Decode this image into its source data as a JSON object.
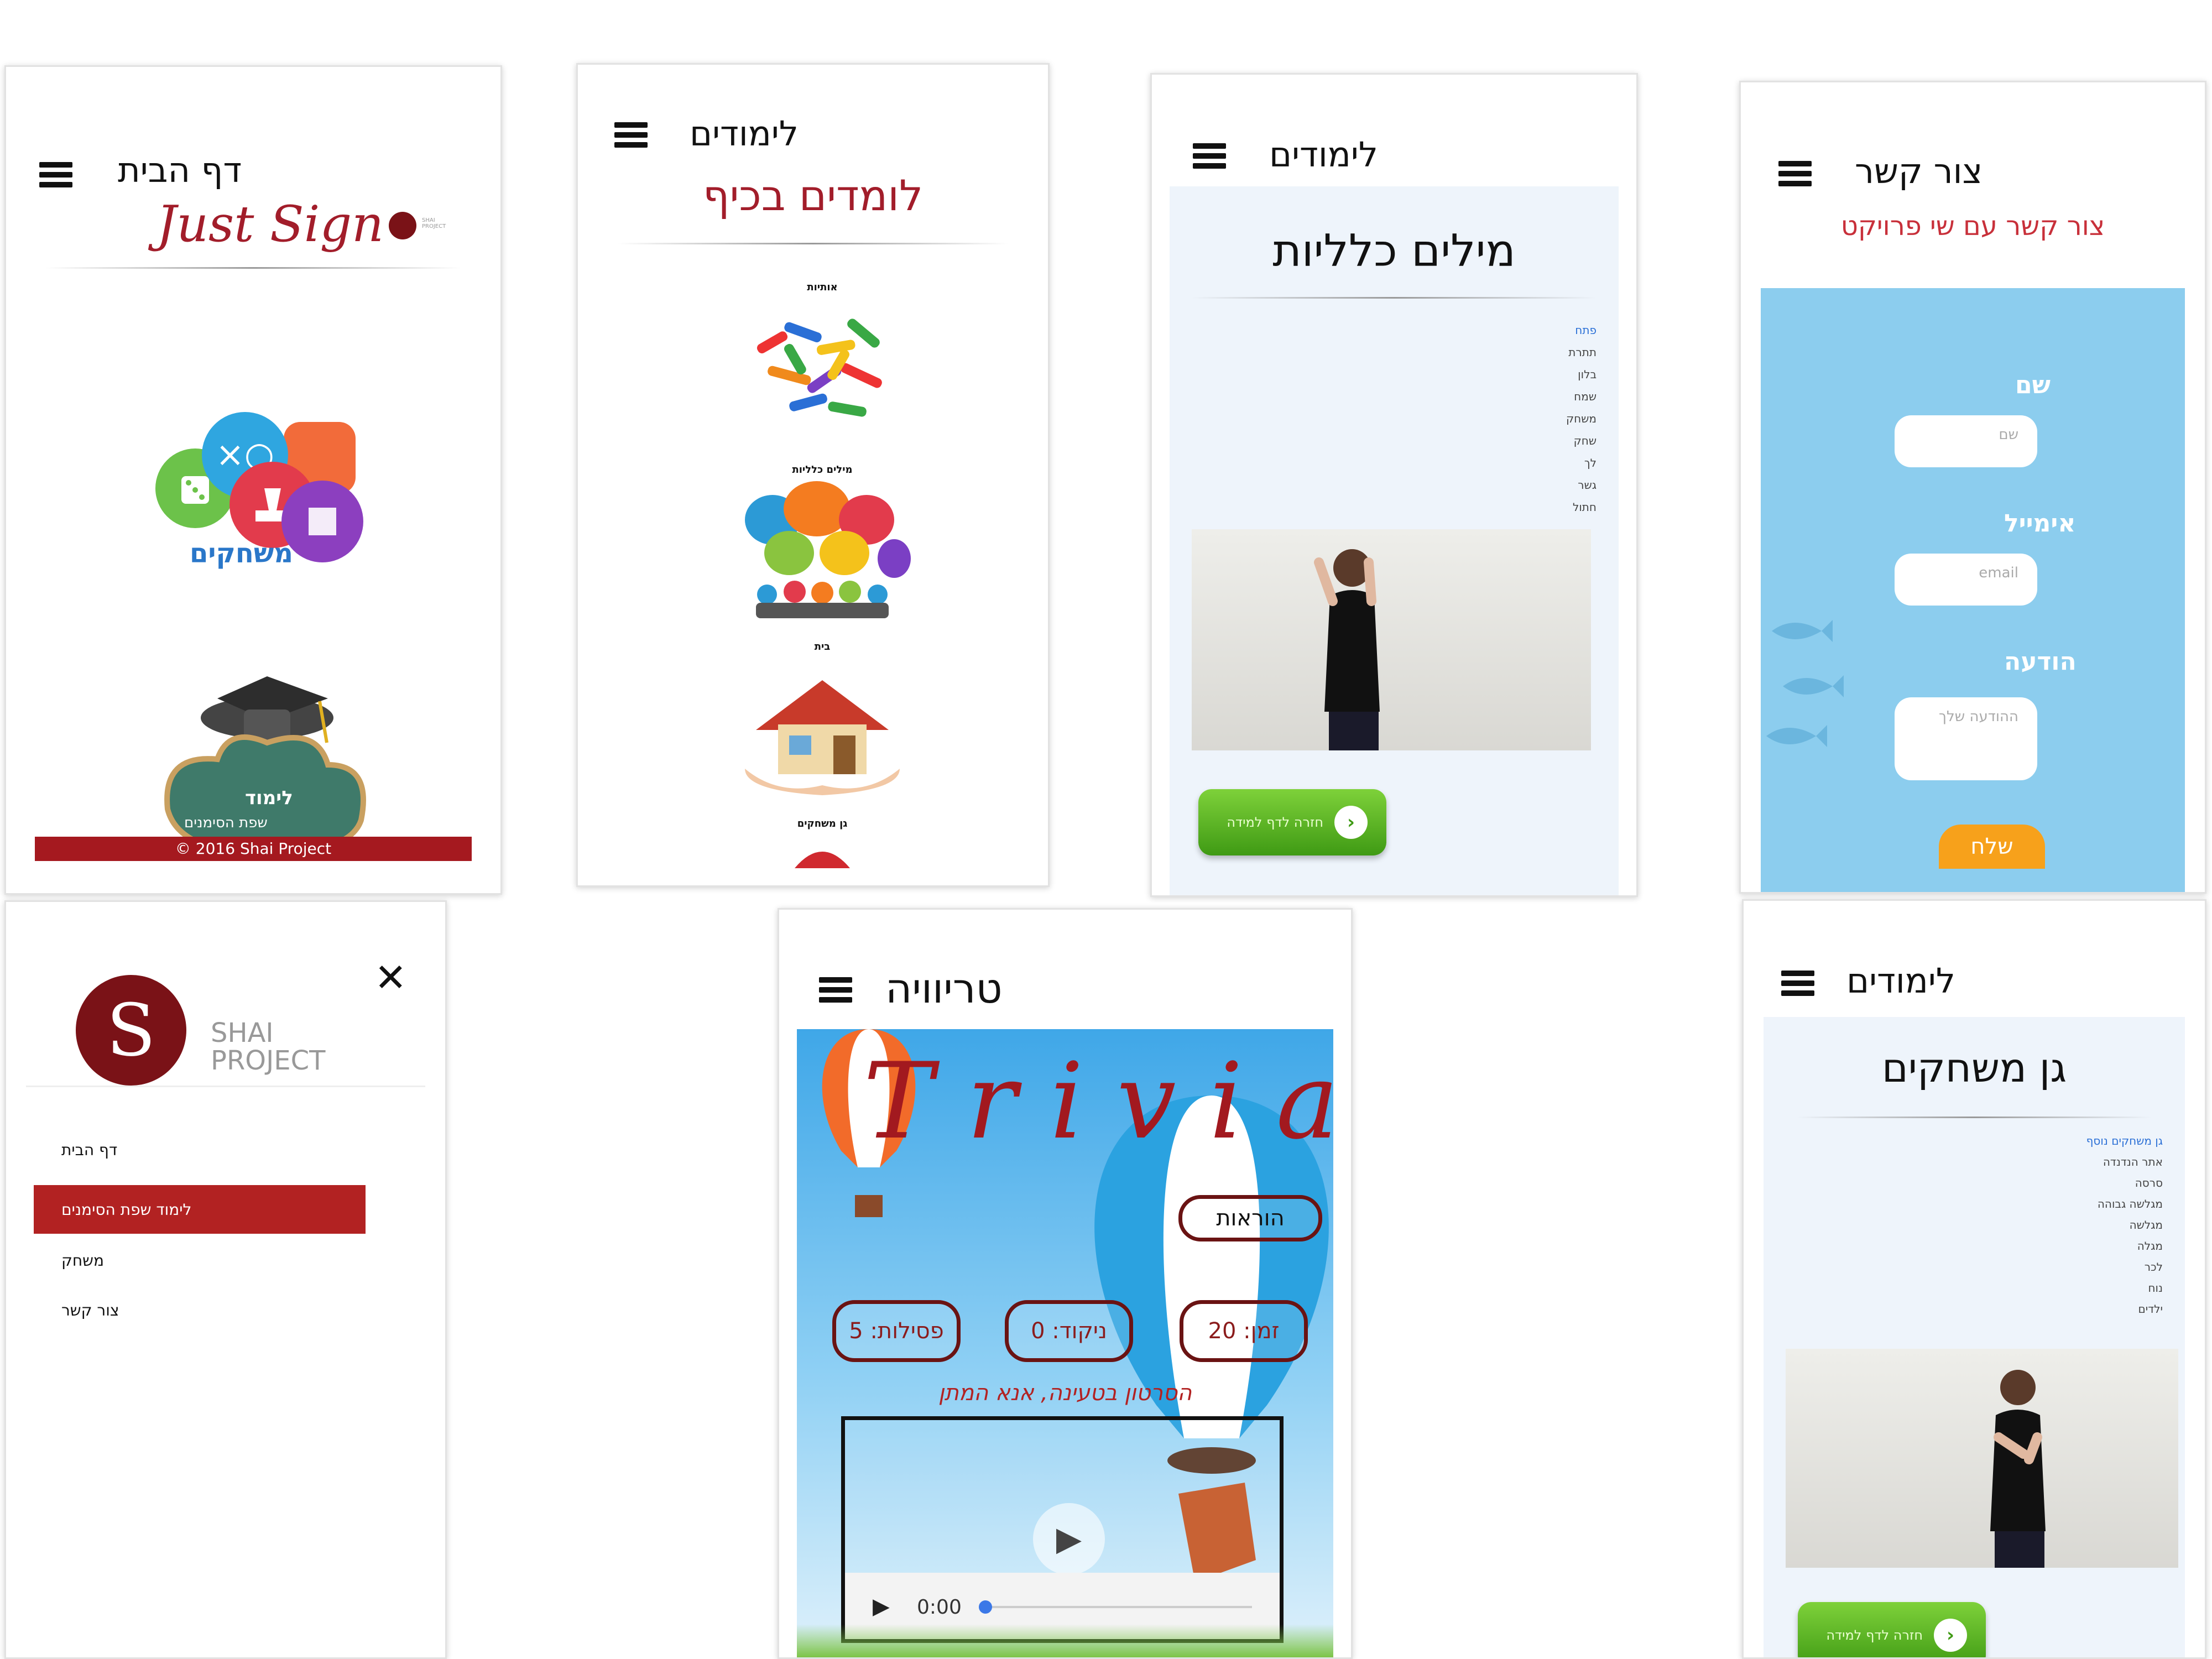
{
  "home": {
    "title": "דף הבית",
    "logo_script": "Just Sign",
    "games_label": "משחקים",
    "learn_label": "לימוד",
    "learn_sub": "שפת הסימנים",
    "footer": "© 2016 Shai Project"
  },
  "learn_menu": {
    "title": "לימודים",
    "subtitle": "לומדים בכיף",
    "items": [
      "אותיות",
      "מילים כלליות",
      "בית",
      "גן משחקים"
    ]
  },
  "general_words": {
    "title": "לימודים",
    "heading": "מילים כלליות",
    "words": [
      "פתח",
      "תתרת",
      "בלון",
      "שמח",
      "משחק",
      "שחק",
      "לך",
      "גשר",
      "חתול"
    ],
    "back_label": "חזרה לדף למידה"
  },
  "contact": {
    "title": "צור קשר",
    "subtitle": "צור קשר עם שי פרויקט",
    "name_label": "שם",
    "name_placeholder": "שם",
    "email_label": "אימייל",
    "email_placeholder": "email",
    "message_label": "הודעה",
    "message_placeholder": "ההודעה שלך",
    "send_label": "שלח"
  },
  "menu_drawer": {
    "logo_line1": "SHAI",
    "logo_line2": "PROJECT",
    "items": [
      "דף הבית",
      "לימוד שפת הסימנים",
      "משחק",
      "צור קשר"
    ],
    "active_index": 1
  },
  "trivia": {
    "title": "טריוויה",
    "logo_text": "Trivia",
    "instructions_label": "הוראות",
    "time_label": "זמן: 20",
    "score_label": "ניקוד: 0",
    "strikes_label": "פסילות: 5",
    "loading_text": "הסרטון בטעינה, אנא המתן",
    "video_time": "0:00"
  },
  "playground": {
    "title": "לימודים",
    "heading": "גן משחקים",
    "words": [
      "גן משחקים נוסף",
      "אתר הנדנדה",
      "סרסה",
      "מגלשה גבוהה",
      "מגלשה",
      "מגלה",
      "לכר",
      "נוח",
      "ילדים"
    ],
    "back_label": "חזרה לדף למידה"
  },
  "colors": {
    "brand_red": "#b22222",
    "contact_blue": "#8ccdee",
    "send_orange": "#f7a11b",
    "sky_blue": "#3fa7e8"
  }
}
